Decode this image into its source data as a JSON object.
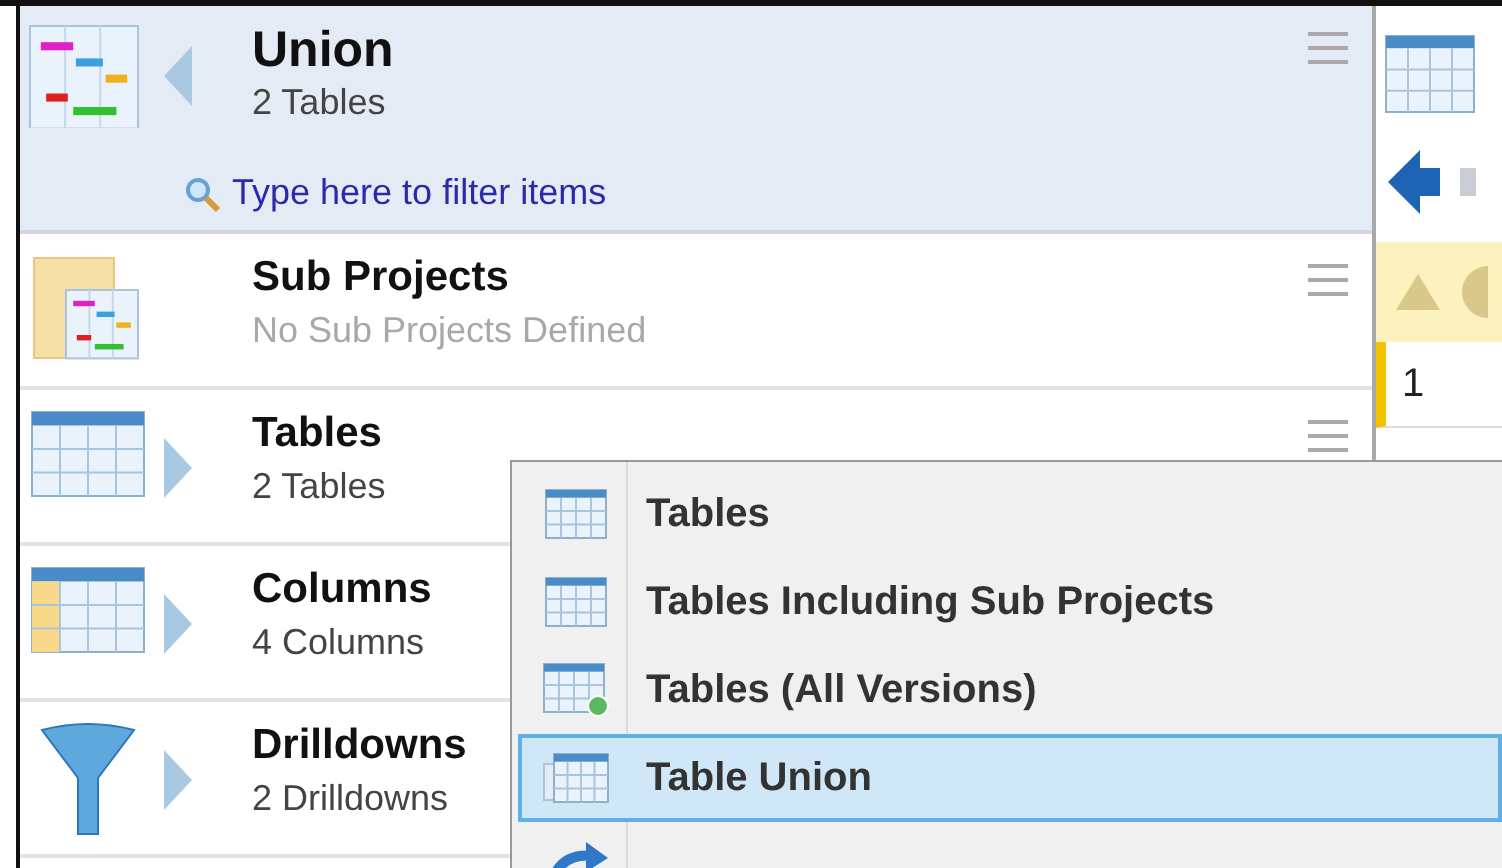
{
  "header": {
    "title": "Union",
    "subtitle": "2 Tables",
    "filter": {
      "placeholder": "Type here to filter items"
    }
  },
  "sections": [
    {
      "kind": "subprojects",
      "title": "Sub Projects",
      "subtitle": "No Sub Projects Defined",
      "empty": true,
      "expandable": false
    },
    {
      "kind": "tables",
      "title": "Tables",
      "subtitle": "2 Tables",
      "empty": false,
      "expandable": true
    },
    {
      "kind": "columns",
      "title": "Columns",
      "subtitle": "4 Columns",
      "empty": false,
      "expandable": true
    },
    {
      "kind": "drilldowns",
      "title": "Drilldowns",
      "subtitle": "2 Drilldowns",
      "empty": false,
      "expandable": true
    }
  ],
  "side_panel": {
    "rows": [
      "1"
    ]
  },
  "context_menu": {
    "items": [
      {
        "kind": "table",
        "label": "Tables",
        "selected": false
      },
      {
        "kind": "table",
        "label": "Tables Including Sub Projects",
        "selected": false
      },
      {
        "kind": "versions",
        "label": "Tables (All Versions)",
        "selected": false
      },
      {
        "kind": "union",
        "label": "Table Union",
        "selected": true
      },
      {
        "kind": "refresh",
        "selected": false
      }
    ]
  }
}
